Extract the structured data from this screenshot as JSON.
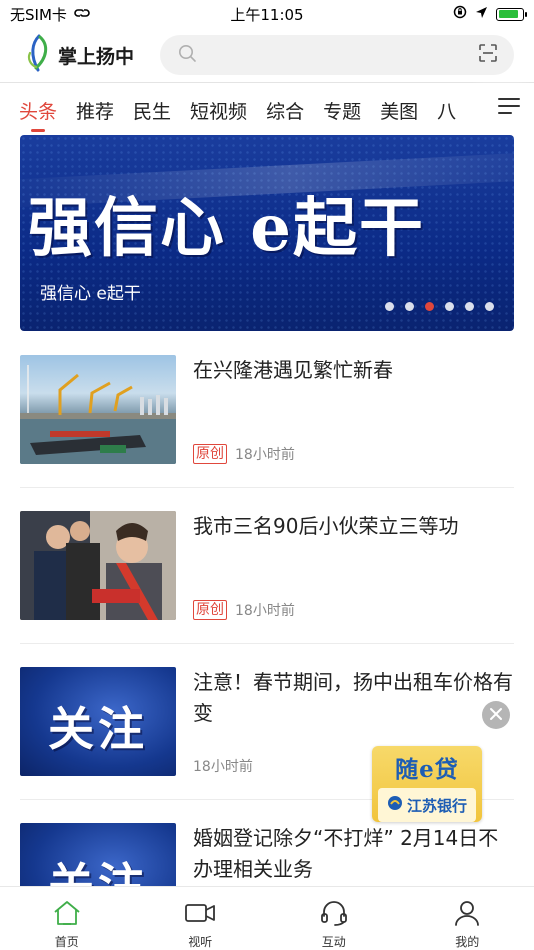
{
  "status_bar": {
    "carrier": "无SIM卡",
    "time": "上午11:05"
  },
  "header": {
    "logo_text": "掌上扬中",
    "search_placeholder": ""
  },
  "tabs": [
    {
      "label": "头条",
      "active": true
    },
    {
      "label": "推荐",
      "active": false
    },
    {
      "label": "民生",
      "active": false
    },
    {
      "label": "短视频",
      "active": false
    },
    {
      "label": "综合",
      "active": false
    },
    {
      "label": "专题",
      "active": false
    },
    {
      "label": "美图",
      "active": false
    },
    {
      "label": "八",
      "active": false
    }
  ],
  "banner": {
    "big_text": "强信心  e起干",
    "caption": "强信心 e起干",
    "dot_count": 6,
    "active_dot": 2
  },
  "articles": [
    {
      "title": "在兴隆港遇见繁忙新春",
      "tag": "原创",
      "time": "18小时前"
    },
    {
      "title": "我市三名90后小伙荣立三等功",
      "tag": "原创",
      "time": "18小时前"
    },
    {
      "title": "注意！春节期间，扬中出租车价格有变",
      "tag": "",
      "time": "18小时前",
      "thumb_text": "关注"
    },
    {
      "title": "婚姻登记除夕“不打烊” 2月14日不办理相关业务",
      "tag": "",
      "time": "",
      "thumb_text": "关注"
    }
  ],
  "ad": {
    "top_text": "随e贷",
    "bottom_text": "江苏银行"
  },
  "bottom_nav": [
    {
      "label": "首页",
      "icon": "home-icon",
      "active": true
    },
    {
      "label": "视听",
      "icon": "video-icon",
      "active": false
    },
    {
      "label": "互动",
      "icon": "headset-icon",
      "active": false
    },
    {
      "label": "我的",
      "icon": "user-icon",
      "active": false
    }
  ],
  "colors": {
    "accent": "#e0473c",
    "nav_active": "#3fae49"
  }
}
